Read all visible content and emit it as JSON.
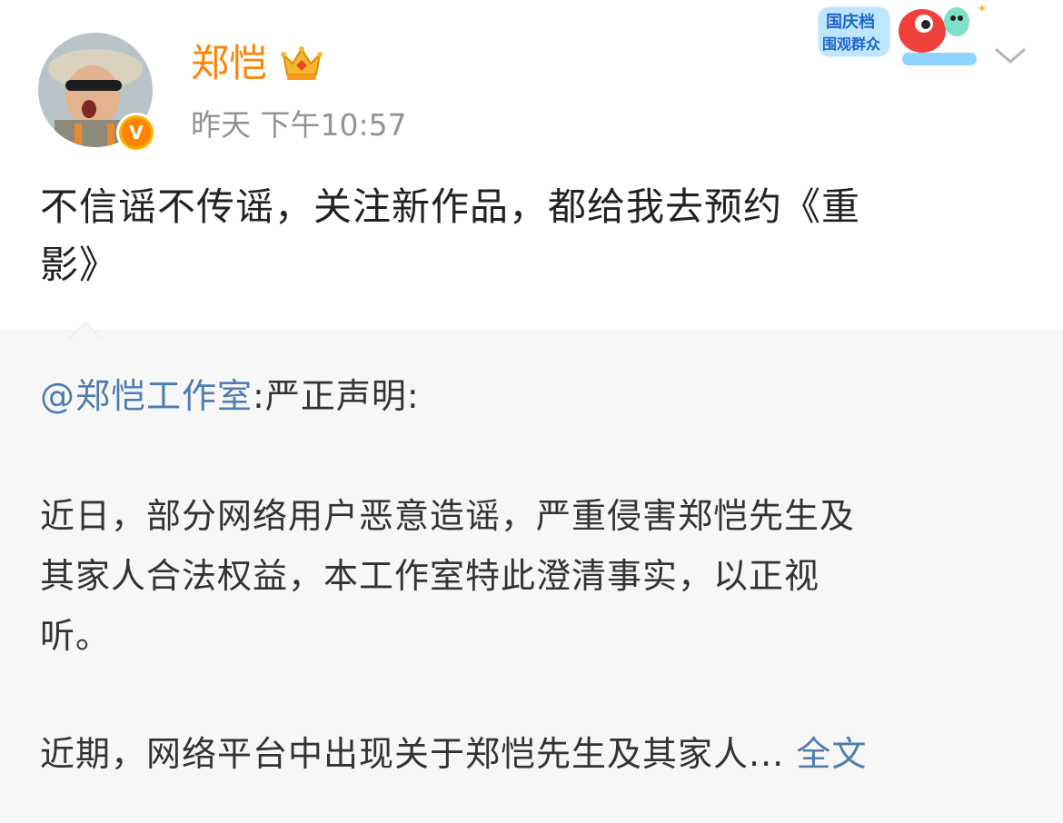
{
  "post": {
    "author": "郑恺",
    "timestamp": "昨天 下午10:57",
    "text_line1": "不信谣不传谣，关注新作品，都给我去预约《重",
    "text_line2": "影》",
    "badge_letter": "V"
  },
  "sticker": {
    "line1": "国庆档",
    "line2": "围观群众"
  },
  "repost": {
    "mention": "@郑恺工作室",
    "mention_suffix": ":严正声明:",
    "para1_line1": "近日，部分网络用户恶意造谣，严重侵害郑恺先生及",
    "para1_line2": "其家人合法权益，本工作室特此澄清事实，以正视",
    "para1_line3": "听。",
    "para2_line1": "近期，网络平台中出现关于郑恺先生及其家人...",
    "fulltext_label": "全文"
  },
  "colors": {
    "username": "#ff8200",
    "link": "#507daf",
    "timestamp": "#939393",
    "repost_bg": "#f7f7f7"
  },
  "icons": [
    "avatar",
    "verified-badge-icon",
    "crown-icon",
    "sticker",
    "chevron-down-icon"
  ]
}
